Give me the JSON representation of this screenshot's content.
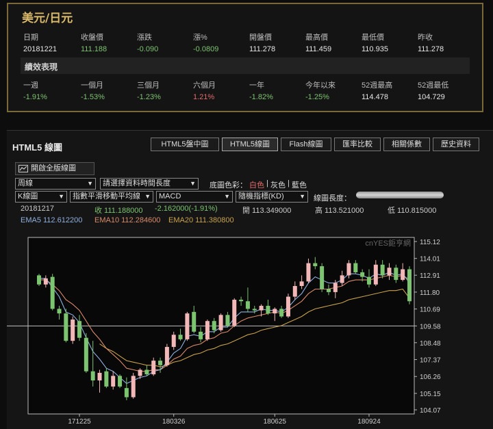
{
  "quote": {
    "title": "美元/日元",
    "headers": [
      "日期",
      "收盤價",
      "漲跌",
      "漲%",
      "開盤價",
      "最高價",
      "最低價",
      "昨收"
    ],
    "values": [
      "20181221",
      "111.188",
      "-0.090",
      "-0.0809",
      "111.278",
      "111.459",
      "110.935",
      "111.278"
    ],
    "perf_title": "績效表現",
    "perf_headers": [
      "一週",
      "一個月",
      "三個月",
      "六個月",
      "一年",
      "今年以來",
      "52週最高",
      "52週最低"
    ],
    "perf_values": [
      "-1.91%",
      "-1.53%",
      "-1.23%",
      "1.21%",
      "-1.82%",
      "-1.25%",
      "114.478",
      "104.729"
    ]
  },
  "chart_panel": {
    "title": "HTML5 線圖",
    "tabs": [
      "HTML5盤中圖",
      "HTML5線圖",
      "Flash線圖",
      "匯率比較",
      "相關係數",
      "歷史資料"
    ],
    "active_tab": 1,
    "full_button": "開啟全版線圖",
    "period_select": "周線",
    "range_select": "請選擇資料時間長度",
    "bg_label": "底圖色彩：",
    "bg_options": [
      "白色",
      "灰色",
      "藍色"
    ],
    "bg_sep": "|",
    "type_select": "K線圖",
    "ma_select": "指數平滑移動平均線",
    "indicator1_select": "MACD",
    "indicator2_select": "隨機指標(KD)",
    "length_label": "線圖長度：",
    "info": {
      "date": "20181217",
      "close": "收 111.188000",
      "change": "-2.162000(-1.91%)",
      "open": "開 113.349000",
      "high": "高 113.521000",
      "low": "低 110.815000",
      "ema5": "EMA5 112.612200",
      "ema10": "EMA10 112.284600",
      "ema20": "EMA20 111.380800"
    },
    "watermark": "cnYES鉅亨網"
  },
  "colors": {
    "up": "#f2b8b8",
    "down": "#7cc470",
    "ema5": "#8fb0e0",
    "ema10": "#d98a6a",
    "ema20": "#c9a24a",
    "accent_gold": "#d9b86a"
  },
  "chart_data": {
    "type": "candlestick",
    "y_ticks": [
      "115.12",
      "114.01",
      "112.91",
      "111.80",
      "110.69",
      "109.58",
      "108.48",
      "107.37",
      "106.26",
      "105.15",
      "104.07"
    ],
    "x_ticks": [
      "171225",
      "180326",
      "180625",
      "180924"
    ],
    "ylim": [
      104.07,
      115.12
    ],
    "reference_line": 109.58,
    "candles": [
      {
        "o": 112.9,
        "h": 113.0,
        "l": 112.2,
        "c": 112.3
      },
      {
        "o": 112.3,
        "h": 112.9,
        "l": 112.1,
        "c": 112.7
      },
      {
        "o": 112.8,
        "h": 113.0,
        "l": 110.6,
        "c": 110.7
      },
      {
        "o": 110.7,
        "h": 110.9,
        "l": 110.0,
        "c": 110.4
      },
      {
        "o": 110.4,
        "h": 110.7,
        "l": 108.5,
        "c": 108.6
      },
      {
        "o": 108.6,
        "h": 110.2,
        "l": 108.4,
        "c": 110.0
      },
      {
        "o": 109.9,
        "h": 110.3,
        "l": 108.6,
        "c": 108.8
      },
      {
        "o": 108.8,
        "h": 109.1,
        "l": 106.5,
        "c": 106.6
      },
      {
        "o": 106.6,
        "h": 108.6,
        "l": 105.6,
        "c": 106.0
      },
      {
        "o": 106.0,
        "h": 106.7,
        "l": 105.2,
        "c": 106.5
      },
      {
        "o": 106.6,
        "h": 106.8,
        "l": 105.5,
        "c": 105.6
      },
      {
        "o": 105.6,
        "h": 106.6,
        "l": 105.4,
        "c": 106.3
      },
      {
        "o": 106.3,
        "h": 106.4,
        "l": 105.5,
        "c": 105.6
      },
      {
        "o": 105.5,
        "h": 106.2,
        "l": 104.7,
        "c": 104.9
      },
      {
        "o": 104.9,
        "h": 106.5,
        "l": 104.8,
        "c": 106.3
      },
      {
        "o": 106.3,
        "h": 106.8,
        "l": 106.1,
        "c": 106.7
      },
      {
        "o": 106.7,
        "h": 107.0,
        "l": 106.3,
        "c": 106.4
      },
      {
        "o": 106.4,
        "h": 107.5,
        "l": 106.3,
        "c": 107.3
      },
      {
        "o": 107.3,
        "h": 107.5,
        "l": 106.5,
        "c": 107.0
      },
      {
        "o": 107.0,
        "h": 108.4,
        "l": 106.9,
        "c": 108.2
      },
      {
        "o": 108.2,
        "h": 109.2,
        "l": 108.0,
        "c": 109.0
      },
      {
        "o": 109.0,
        "h": 109.4,
        "l": 108.6,
        "c": 108.7
      },
      {
        "o": 108.7,
        "h": 110.5,
        "l": 108.6,
        "c": 110.4
      },
      {
        "o": 110.5,
        "h": 110.9,
        "l": 109.1,
        "c": 109.2
      },
      {
        "o": 109.2,
        "h": 109.5,
        "l": 108.5,
        "c": 108.7
      },
      {
        "o": 108.7,
        "h": 110.0,
        "l": 108.6,
        "c": 109.9
      },
      {
        "o": 109.9,
        "h": 110.1,
        "l": 109.1,
        "c": 109.3
      },
      {
        "o": 109.3,
        "h": 110.4,
        "l": 109.2,
        "c": 110.3
      },
      {
        "o": 110.3,
        "h": 110.5,
        "l": 109.5,
        "c": 109.6
      },
      {
        "o": 109.6,
        "h": 111.4,
        "l": 109.5,
        "c": 111.3
      },
      {
        "o": 111.3,
        "h": 111.5,
        "l": 110.9,
        "c": 111.2
      },
      {
        "o": 111.2,
        "h": 112.1,
        "l": 110.5,
        "c": 110.7
      },
      {
        "o": 110.7,
        "h": 110.9,
        "l": 110.4,
        "c": 110.6
      },
      {
        "o": 110.6,
        "h": 111.0,
        "l": 110.2,
        "c": 110.9
      },
      {
        "o": 110.9,
        "h": 111.3,
        "l": 110.3,
        "c": 110.4
      },
      {
        "o": 110.4,
        "h": 110.8,
        "l": 109.9,
        "c": 110.7
      },
      {
        "o": 110.7,
        "h": 110.9,
        "l": 110.1,
        "c": 110.2
      },
      {
        "o": 110.2,
        "h": 111.7,
        "l": 110.1,
        "c": 111.5
      },
      {
        "o": 111.5,
        "h": 112.5,
        "l": 111.3,
        "c": 112.2
      },
      {
        "o": 112.2,
        "h": 112.9,
        "l": 112.0,
        "c": 112.5
      },
      {
        "o": 112.5,
        "h": 114.0,
        "l": 112.4,
        "c": 113.7
      },
      {
        "o": 113.7,
        "h": 114.1,
        "l": 113.3,
        "c": 113.5
      },
      {
        "o": 113.5,
        "h": 113.7,
        "l": 111.8,
        "c": 112.0
      },
      {
        "o": 112.0,
        "h": 112.3,
        "l": 111.6,
        "c": 111.8
      },
      {
        "o": 111.8,
        "h": 112.6,
        "l": 111.4,
        "c": 112.4
      },
      {
        "o": 112.4,
        "h": 113.2,
        "l": 112.2,
        "c": 112.9
      },
      {
        "o": 112.9,
        "h": 113.9,
        "l": 112.7,
        "c": 113.7
      },
      {
        "o": 113.7,
        "h": 113.9,
        "l": 113.0,
        "c": 113.1
      },
      {
        "o": 113.1,
        "h": 113.3,
        "l": 112.5,
        "c": 112.8
      },
      {
        "o": 112.8,
        "h": 113.3,
        "l": 112.1,
        "c": 112.3
      },
      {
        "o": 112.3,
        "h": 113.9,
        "l": 112.2,
        "c": 113.6
      },
      {
        "o": 113.6,
        "h": 113.9,
        "l": 112.7,
        "c": 112.9
      },
      {
        "o": 112.9,
        "h": 113.7,
        "l": 112.6,
        "c": 113.4
      },
      {
        "o": 113.4,
        "h": 113.6,
        "l": 112.4,
        "c": 112.6
      },
      {
        "o": 112.6,
        "h": 113.7,
        "l": 112.5,
        "c": 113.3
      },
      {
        "o": 113.3,
        "h": 113.5,
        "l": 111.0,
        "c": 111.2
      }
    ],
    "ema5": [
      112.7,
      112.7,
      112.1,
      111.5,
      110.5,
      110.3,
      109.8,
      108.8,
      107.9,
      107.4,
      106.8,
      106.6,
      106.2,
      105.8,
      106.0,
      106.2,
      106.3,
      106.6,
      106.7,
      107.2,
      107.8,
      108.1,
      108.9,
      109.0,
      108.9,
      109.2,
      109.2,
      109.5,
      109.5,
      110.1,
      110.5,
      110.5,
      110.5,
      110.7,
      110.6,
      110.6,
      110.5,
      110.8,
      111.3,
      111.7,
      112.4,
      112.8,
      112.6,
      112.4,
      112.4,
      112.6,
      113.0,
      113.0,
      112.9,
      112.7,
      113.0,
      112.9,
      113.1,
      112.9,
      113.0,
      112.4
    ],
    "ema10": [
      112.6,
      112.6,
      112.3,
      111.9,
      111.3,
      111.0,
      110.6,
      109.9,
      109.2,
      108.7,
      108.1,
      107.7,
      107.3,
      106.8,
      106.7,
      106.6,
      106.6,
      106.7,
      106.7,
      107.0,
      107.4,
      107.6,
      108.1,
      108.3,
      108.4,
      108.7,
      108.8,
      109.1,
      109.2,
      109.6,
      109.9,
      110.1,
      110.2,
      110.3,
      110.4,
      110.5,
      110.4,
      110.6,
      110.9,
      111.2,
      111.7,
      112.0,
      112.0,
      112.0,
      112.1,
      112.2,
      112.5,
      112.6,
      112.6,
      112.6,
      112.7,
      112.8,
      112.9,
      112.8,
      112.9,
      112.6
    ],
    "ema20": [
      null,
      null,
      null,
      null,
      null,
      null,
      null,
      null,
      null,
      108.4,
      108.1,
      107.9,
      107.6,
      107.3,
      107.2,
      107.1,
      107.0,
      107.0,
      106.9,
      107.0,
      107.2,
      107.3,
      107.5,
      107.7,
      107.8,
      108.0,
      108.1,
      108.3,
      108.4,
      108.6,
      108.8,
      109.0,
      109.1,
      109.3,
      109.4,
      109.5,
      109.6,
      109.8,
      110.0,
      110.2,
      110.5,
      110.7,
      110.8,
      110.9,
      111.0,
      111.1,
      111.3,
      111.4,
      111.5,
      111.6,
      111.7,
      111.8,
      111.9,
      111.9,
      112.0,
      111.4
    ]
  }
}
